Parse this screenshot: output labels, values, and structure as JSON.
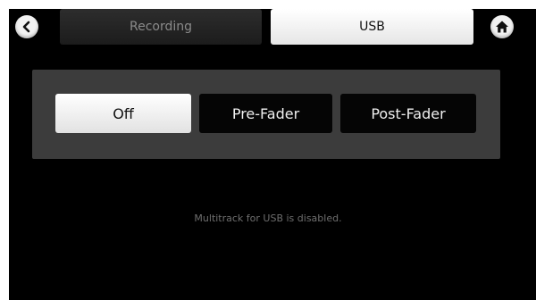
{
  "tabs": [
    {
      "label": "Recording",
      "selected": false
    },
    {
      "label": "USB",
      "selected": true
    }
  ],
  "multitrack_mode": {
    "options": [
      "Off",
      "Pre-Fader",
      "Post-Fader"
    ],
    "selected": "Off"
  },
  "status_message": "Multitrack for USB is disabled.",
  "icons": {
    "back": "chevron-left-icon",
    "home": "home-icon"
  },
  "colors": {
    "background": "#000000",
    "panel": "#3c3c3c",
    "selected_button": "#ffffff",
    "unselected_button": "#050505"
  }
}
